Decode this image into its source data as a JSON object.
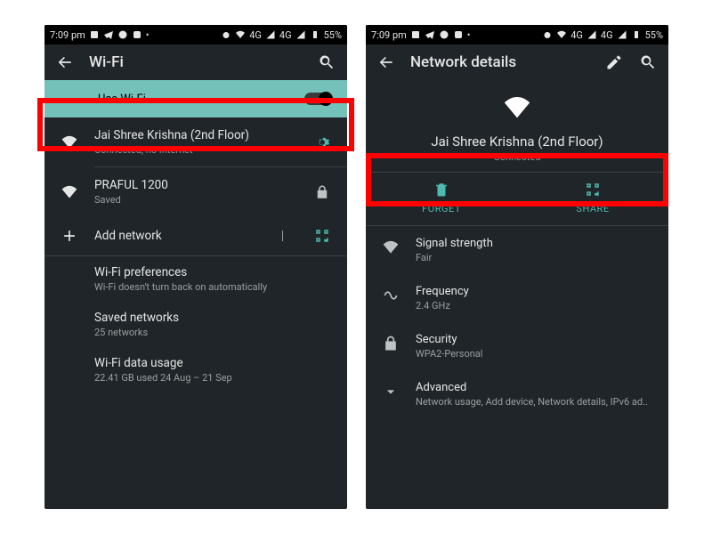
{
  "statusbar": {
    "time": "7:09 pm",
    "sig_label": "4G",
    "battery": "55%"
  },
  "left": {
    "header_title": "Wi-Fi",
    "use_wifi_label": "Use Wi-Fi",
    "ssid_connected": "Jai Shree Krishna (2nd Floor)",
    "ssid_connected_sub": "Connected, no Internet",
    "ssid_saved": "PRAFUL 1200",
    "ssid_saved_sub": "Saved",
    "add_network": "Add network",
    "pref_title": "Wi-Fi preferences",
    "pref_sub": "Wi-Fi doesn't turn back on automatically",
    "saved_title": "Saved networks",
    "saved_sub": "25 networks",
    "usage_title": "Wi-Fi data usage",
    "usage_sub": "22.41 GB used 24 Aug – 21 Sep"
  },
  "right": {
    "header_title": "Network details",
    "ssid": "Jai Shree Krishna (2nd Floor)",
    "status": "Connected",
    "forget": "FORGET",
    "share": "SHARE",
    "signal_label": "Signal strength",
    "signal_value": "Fair",
    "freq_label": "Frequency",
    "freq_value": "2.4 GHz",
    "sec_label": "Security",
    "sec_value": "WPA2-Personal",
    "adv_label": "Advanced",
    "adv_value": "Network usage, Add device, Network details, IPv6 ad.."
  }
}
